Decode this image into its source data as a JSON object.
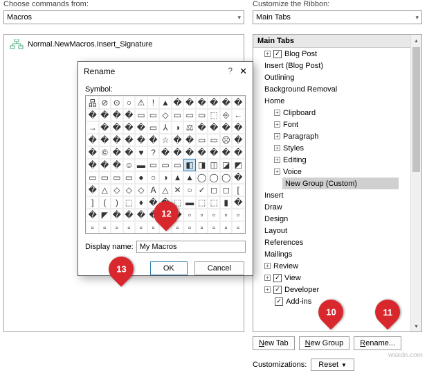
{
  "left": {
    "choose_label": "Choose commands from:",
    "choose_value": "Macros",
    "tree_item": "Normal.NewMacros.Insert_Signature"
  },
  "right": {
    "customize_label": "Customize the Ribbon:",
    "customize_value": "Main Tabs",
    "header": "Main Tabs",
    "tabs": [
      {
        "label": "Blog Post",
        "depth": 1,
        "checked": true,
        "expand": "+"
      },
      {
        "label": "Insert (Blog Post)",
        "depth": 1,
        "checked": null,
        "expand": null,
        "prefix": ""
      },
      {
        "label": "Outlining",
        "depth": 1,
        "checked": null,
        "expand": null,
        "prefix": ""
      },
      {
        "label": "Background Removal",
        "depth": 1,
        "checked": null,
        "expand": null,
        "prefix": ""
      },
      {
        "label": "Home",
        "depth": 1,
        "checked": null,
        "expand": null,
        "prefix": ""
      },
      {
        "label": "Clipboard",
        "depth": 2,
        "expand": "+"
      },
      {
        "label": "Font",
        "depth": 2,
        "expand": "+"
      },
      {
        "label": "Paragraph",
        "depth": 2,
        "expand": "+"
      },
      {
        "label": "Styles",
        "depth": 2,
        "expand": "+"
      },
      {
        "label": "Editing",
        "depth": 2,
        "expand": "+"
      },
      {
        "label": "Voice",
        "depth": 2,
        "expand": "+"
      },
      {
        "label": "New Group (Custom)",
        "depth": 3,
        "selected": true
      },
      {
        "label": "Insert",
        "depth": 1
      },
      {
        "label": "Draw",
        "depth": 1
      },
      {
        "label": "Design",
        "depth": 1
      },
      {
        "label": "Layout",
        "depth": 1
      },
      {
        "label": "References",
        "depth": 1
      },
      {
        "label": "Mailings",
        "depth": 1
      },
      {
        "label": "Review",
        "depth": 1,
        "expand": "+"
      },
      {
        "label": "View",
        "depth": 1,
        "checked": true,
        "expand": "+"
      },
      {
        "label": "Developer",
        "depth": 1,
        "checked": true,
        "expand": "+"
      },
      {
        "label": "Add-ins",
        "depth": 1,
        "checked": true
      }
    ],
    "buttons": {
      "new_tab": "New Tab",
      "new_group": "New Group",
      "rename": "Rename..."
    },
    "customizations_label": "Customizations:",
    "reset": "Reset"
  },
  "dialog": {
    "title": "Rename",
    "symbol_label": "Symbol:",
    "display_label": "Display name:",
    "display_value": "My Macros",
    "ok": "OK",
    "cancel": "Cancel"
  },
  "callouts": {
    "c10": "10",
    "c11": "11",
    "c12": "12",
    "c13": "13"
  },
  "watermark": "wsxdn.com"
}
